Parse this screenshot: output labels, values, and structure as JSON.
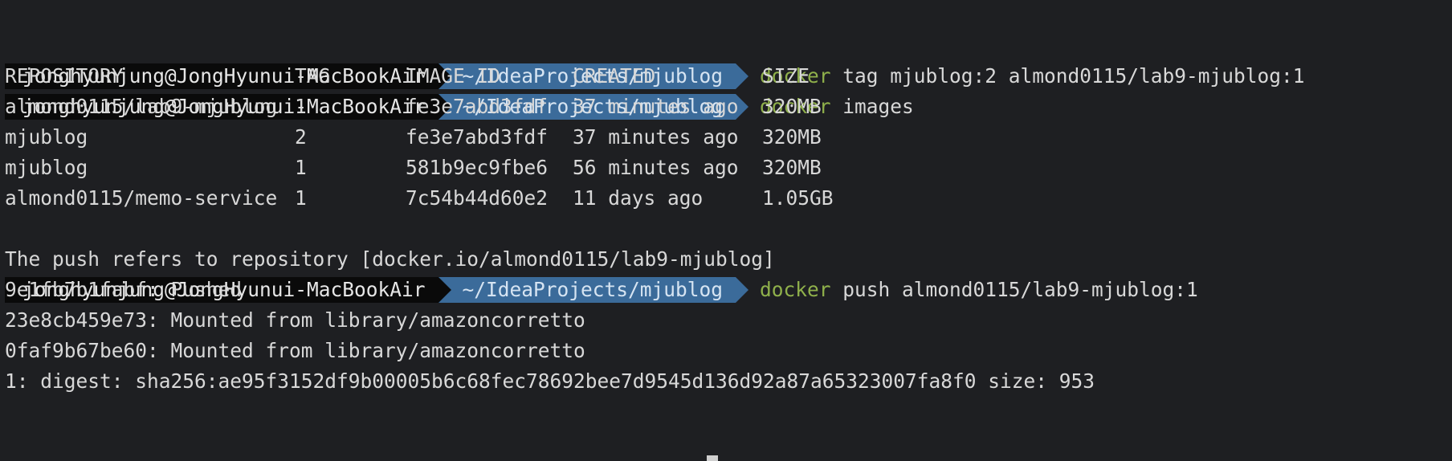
{
  "prompt": {
    "user_host": "jonghyunjung@JongHyunui-MacBookAir",
    "path": "~/IdeaProjects/mjublog"
  },
  "commands": [
    {
      "name": "docker",
      "args": " tag mjublog:2 almond0115/lab9-mjublog:1"
    },
    {
      "name": "docker",
      "args": " images"
    },
    {
      "name": "docker",
      "args": " push almond0115/lab9-mjublog:1"
    }
  ],
  "images_table": {
    "headers": [
      "REPOSITORY",
      "TAG",
      "IMAGE ID",
      "CREATED",
      "SIZE"
    ],
    "rows": [
      [
        "almond0115/lab9-mjublog",
        "1",
        "fe3e7abd3fdf",
        "37 minutes ago",
        "320MB"
      ],
      [
        "mjublog",
        "2",
        "fe3e7abd3fdf",
        "37 minutes ago",
        "320MB"
      ],
      [
        "mjublog",
        "1",
        "581b9ec9fbe6",
        "56 minutes ago",
        "320MB"
      ],
      [
        "almond0115/memo-service",
        "1",
        "7c54b44d60e2",
        "11 days ago",
        "1.05GB"
      ]
    ]
  },
  "push_output": [
    "The push refers to repository [docker.io/almond0115/lab9-mjublog]",
    "9e1fb7b1fabf: Pushed",
    "23e8cb459e73: Mounted from library/amazoncorretto",
    "0faf9b67be60: Mounted from library/amazoncorretto",
    "1: digest: sha256:ae95f3152df9b00005b6c68fec78692bee7d9545d136d92a87a65323007fa8f0 size: 953"
  ],
  "colors": {
    "background": "#1e1f22",
    "user_segment": "#0a0a0a",
    "path_segment": "#3b6b9a",
    "command_name": "#8fb04b",
    "text": "#d8d8d8"
  }
}
